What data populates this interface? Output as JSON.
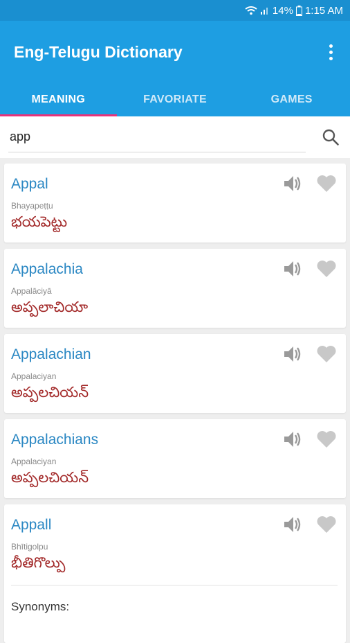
{
  "status_bar": {
    "battery": "14%",
    "time": "1:15 AM"
  },
  "app_bar": {
    "title": "Eng-Telugu Dictionary"
  },
  "tabs": [
    {
      "label": "MEANING",
      "active": true
    },
    {
      "label": "FAVORIATE",
      "active": false
    },
    {
      "label": "GAMES",
      "active": false
    }
  ],
  "search": {
    "value": "app",
    "placeholder": ""
  },
  "entries": [
    {
      "word": "Appal",
      "transliteration": "Bhayapeṭṭu",
      "telugu": "భయపెట్టు"
    },
    {
      "word": "Appalachia",
      "transliteration": "Appalāciyā",
      "telugu": "అప్పలాచియా"
    },
    {
      "word": "Appalachian",
      "transliteration": "Appalaciyan",
      "telugu": "అప్పలచియన్"
    },
    {
      "word": "Appalachians",
      "transliteration": "Appalaciyan",
      "telugu": "అప్పలచియన్"
    },
    {
      "word": "Appall",
      "transliteration": "Bhītigolpu",
      "telugu": "భీతిగొల్పు",
      "synonyms_label": "Synonyms:",
      "synonyms": ""
    }
  ],
  "colors": {
    "primary": "#1e9ee2",
    "status_bar": "#1a8fd0",
    "tab_indicator": "#e8327a",
    "word": "#2a87c3",
    "telugu": "#a32a2a"
  }
}
